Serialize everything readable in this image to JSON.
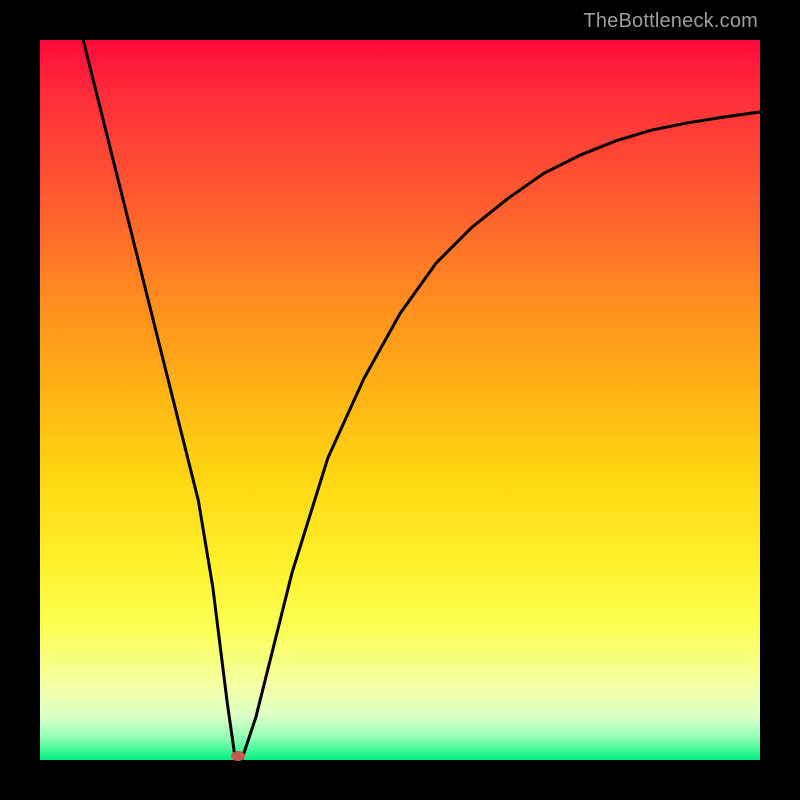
{
  "watermark": "TheBottleneck.com",
  "chart_data": {
    "type": "line",
    "title": "",
    "xlabel": "",
    "ylabel": "",
    "xlim": [
      0,
      100
    ],
    "ylim": [
      0,
      100
    ],
    "grid": false,
    "legend": false,
    "annotations": [],
    "series": [
      {
        "name": "curve",
        "x": [
          6,
          10,
          15,
          20,
          22,
          24,
          26,
          27,
          28,
          30,
          35,
          40,
          45,
          50,
          55,
          60,
          65,
          70,
          75,
          80,
          85,
          90,
          95,
          100
        ],
        "values": [
          100,
          84,
          64,
          44,
          36,
          24,
          8,
          1,
          0,
          6,
          26,
          42,
          53,
          62,
          69,
          74,
          78,
          81.5,
          84,
          86,
          87.5,
          88.5,
          89.3,
          90
        ]
      }
    ],
    "marker": {
      "x": 27.5,
      "y": 0.5,
      "color": "#c85a4a"
    }
  },
  "colors": {
    "frame": "#000000",
    "curve": "#000000",
    "marker": "#c85a4a",
    "watermark": "#9d9d9d"
  }
}
